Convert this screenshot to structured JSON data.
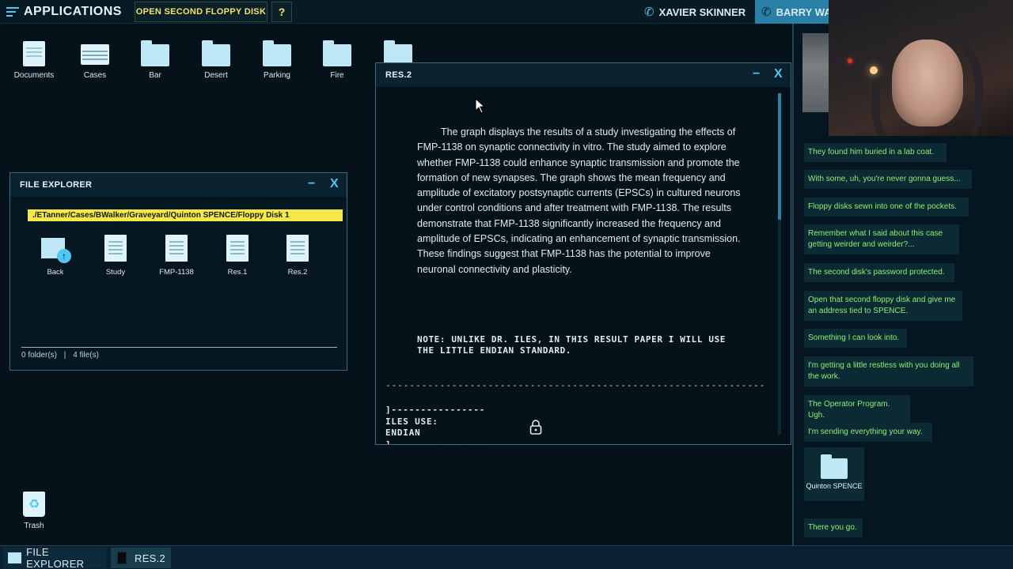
{
  "topbar": {
    "apps_label": "APPLICATIONS",
    "task_label": "OPEN SECOND FLOPPY DISK",
    "help_label": "?",
    "calls": [
      {
        "name": "XAVIER SKINNER",
        "icon": "phone-icon"
      },
      {
        "name": "BARRY WA",
        "icon": "phone-icon"
      }
    ]
  },
  "desktop": {
    "icons": [
      {
        "label": "Documents",
        "icon": "documents-icon"
      },
      {
        "label": "Cases",
        "icon": "cases-icon"
      },
      {
        "label": "Bar",
        "icon": "folder-icon"
      },
      {
        "label": "Desert",
        "icon": "folder-icon"
      },
      {
        "label": "Parking",
        "icon": "folder-icon"
      },
      {
        "label": "Fire",
        "icon": "folder-icon"
      }
    ],
    "trash_label": "Trash"
  },
  "file_explorer": {
    "title": "FILE EXPLORER",
    "minimize": "−",
    "close": "X",
    "path": "./ETanner/Cases/BWalker/Graveyard/Quinton SPENCE/Floppy Disk 1",
    "items": [
      {
        "label": "Back",
        "icon": "back-folder-icon"
      },
      {
        "label": "Study",
        "icon": "file-icon"
      },
      {
        "label": "FMP-1138",
        "icon": "file-icon"
      },
      {
        "label": "Res.1",
        "icon": "file-icon"
      },
      {
        "label": "Res.2",
        "icon": "file-icon"
      }
    ],
    "folder_count": "0 folder(s)",
    "separator": "|",
    "file_count": "4 file(s)"
  },
  "res_window": {
    "title": "RES.2",
    "minimize": "−",
    "close": "X",
    "paragraph": "The graph displays the results of a study investigating the effects of FMP-1138 on synaptic connectivity in vitro. The study aimed to explore whether FMP-1138 could enhance synaptic transmission and promote the formation of new synapses. The graph shows the mean frequency and amplitude of excitatory postsynaptic currents (EPSCs) in cultured neurons under control conditions and after treatment with FMP-1138. The results demonstrate that FMP-1138 significantly increased the frequency and amplitude of EPSCs, indicating an enhancement of synaptic transmission. These findings suggest that FMP-1138 has the potential to improve neuronal connectivity and plasticity.",
    "note": "NOTE: UNLIKE DR. ILES, IN THIS RESULT PAPER I WILL USE THE LITTLE ENDIAN STANDARD.",
    "dashes": "---------------------------------------------------------------",
    "code_block": "]----------------\nILES USE:\nENDIAN\n]----------------"
  },
  "chat": {
    "messages": [
      "They found him buried in a lab coat.",
      "With some, uh, you're never gonna guess...",
      "Floppy disks sewn into one of the pockets.",
      "Remember what I said about this case getting weirder and weirder?...",
      "The second disk's password protected.",
      "Open that second floppy disk and give me an address tied to SPENCE.",
      "Something I can look into.",
      "I'm getting a little restless with you doing all the work.",
      "The Operator Program. Ugh.",
      "I'm sending everything your way."
    ],
    "attachment_label": "Quinton SPENCE",
    "last_message": "There you go."
  },
  "taskbar": {
    "items": [
      {
        "label": "FILE EXPLORER"
      },
      {
        "label": "RES.2"
      }
    ]
  },
  "colors": {
    "background": "#05121a",
    "accent": "#4fc7f0",
    "path_highlight": "#f3e94a",
    "chat_text": "#8df078",
    "task_text": "#f2e46a"
  }
}
